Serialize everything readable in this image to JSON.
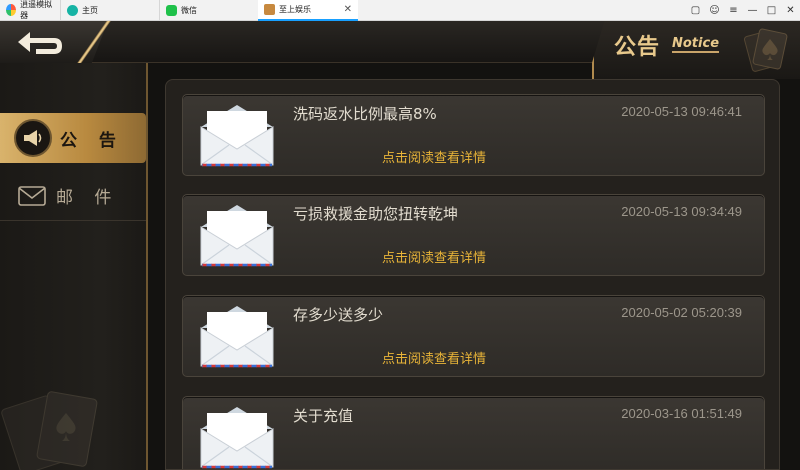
{
  "emulator": {
    "brand_label": "逍遥模拟器",
    "tabs": [
      {
        "label": "主页"
      },
      {
        "label": "微信"
      },
      {
        "label": "至上娱乐",
        "close": "✕"
      }
    ],
    "window_controls": [
      "▢",
      "☺",
      "≡",
      "—",
      "□",
      "✕"
    ]
  },
  "header": {
    "back_icon": "back-arrow-icon",
    "notice_title_zh": "公告",
    "notice_title_en": "Notice"
  },
  "sidebar": {
    "items": [
      {
        "label": "公 告",
        "icon": "megaphone-icon",
        "active": true
      },
      {
        "label": "邮 件",
        "icon": "envelope-icon",
        "active": false
      }
    ]
  },
  "messages": [
    {
      "title": "洗码返水比例最高8%",
      "time": "2020-05-13 09:46:41",
      "link": "点击阅读查看详情"
    },
    {
      "title": "亏损救援金助您扭转乾坤",
      "time": "2020-05-13 09:34:49",
      "link": "点击阅读查看详情"
    },
    {
      "title": "存多少送多少",
      "time": "2020-05-02 05:20:39",
      "link": "点击阅读查看详情"
    },
    {
      "title": "关于充值",
      "time": "2020-03-16 01:51:49",
      "link": ""
    }
  ],
  "colors": {
    "accent_gold": "#d9b36c",
    "link_yellow": "#e8b438",
    "active_tab_underline": "#18a0ff"
  }
}
